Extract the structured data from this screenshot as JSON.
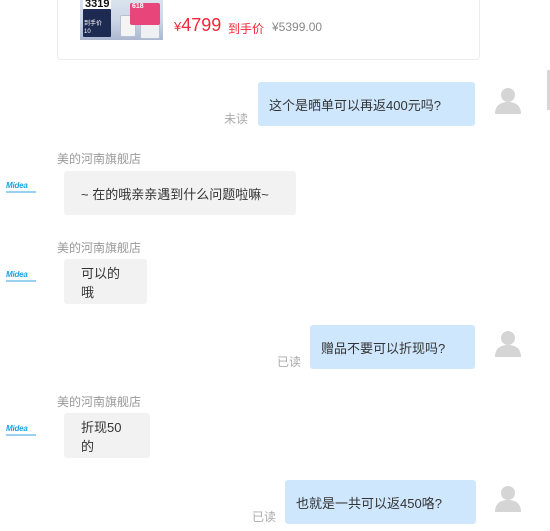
{
  "product": {
    "thumb_price": "3319",
    "thumb_badge": "618",
    "thumb_line1": "到手价",
    "thumb_line2": "10",
    "currency": "¥",
    "price": "4799",
    "price_label": "到手价",
    "original_price": "¥5399.00"
  },
  "messages": [
    {
      "side": "right",
      "text": "这个是晒单可以再返400元吗?",
      "status": "未读"
    },
    {
      "side": "left",
      "sender": "美的河南旗舰店",
      "text": "~ 在的哦亲亲遇到什么问题啦嘛~"
    },
    {
      "side": "left",
      "sender": "美的河南旗舰店",
      "text": "可以的哦"
    },
    {
      "side": "right",
      "text": "赠品不要可以折现吗?",
      "status": "已读"
    },
    {
      "side": "left",
      "sender": "美的河南旗舰店",
      "text": "折现50的"
    },
    {
      "side": "right",
      "text": "也就是一共可以返450咯?",
      "status": "已读"
    }
  ],
  "shop_logo": "Midea",
  "colors": {
    "price_red": "#f2273a",
    "bubble_self": "#cfe7fd",
    "bubble_other": "#f2f2f2",
    "brand_blue": "#1aa3e0"
  },
  "icons": {
    "user_avatar": "person-silhouette-icon",
    "shop_avatar": "midea-logo"
  }
}
